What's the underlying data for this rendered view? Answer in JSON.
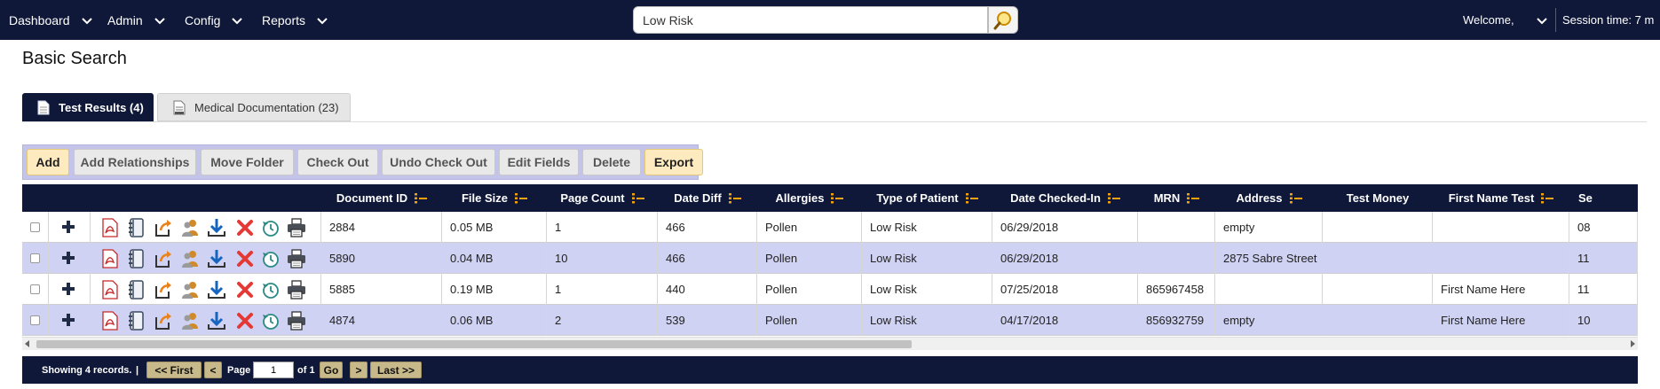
{
  "nav": {
    "items": [
      "Dashboard",
      "Admin",
      "Config",
      "Reports"
    ],
    "search_value": "Low Risk",
    "welcome": "Welcome,",
    "session": "Session time: 7 m"
  },
  "page_title": "Basic Search",
  "tabs": [
    {
      "label": "Test Results (4)",
      "active": true
    },
    {
      "label": "Medical Documentation (23)",
      "active": false
    }
  ],
  "toolbar": {
    "buttons": [
      "Add",
      "Add Relationships",
      "Move Folder",
      "Check Out",
      "Undo Check Out",
      "Edit Fields",
      "Delete",
      "Export"
    ]
  },
  "grid": {
    "columns": [
      "Document ID",
      "File Size",
      "Page Count",
      "Date Diff",
      "Allergies",
      "Type of Patient",
      "Date Checked-In",
      "MRN",
      "Address",
      "Test Money",
      "First Name Test",
      "Se"
    ],
    "row_icons": [
      "pdf-icon",
      "notebook-icon",
      "export-arrow-icon",
      "users-icon",
      "download-icon",
      "delete-x-icon",
      "history-icon",
      "print-icon"
    ],
    "rows": [
      [
        "2884",
        "0.05 MB",
        "1",
        "466",
        "Pollen",
        "Low Risk",
        "06/29/2018",
        "",
        "empty",
        "",
        "",
        "08"
      ],
      [
        "5890",
        "0.04 MB",
        "10",
        "466",
        "Pollen",
        "Low Risk",
        "06/29/2018",
        "",
        "2875 Sabre Street",
        "",
        "",
        "11"
      ],
      [
        "5885",
        "0.19 MB",
        "1",
        "440",
        "Pollen",
        "Low Risk",
        "07/25/2018",
        "865967458",
        "",
        "",
        "First Name Here",
        "11"
      ],
      [
        "4874",
        "0.06 MB",
        "2",
        "539",
        "Pollen",
        "Low Risk",
        "04/17/2018",
        "856932759",
        "empty",
        "",
        "First Name Here",
        "10"
      ]
    ]
  },
  "pager": {
    "showing": "Showing 4 records.",
    "separator": "|",
    "first": "<< First",
    "prev": "<",
    "page_label": "Page",
    "page_value": "1",
    "of_label": "of 1",
    "go": "Go",
    "next": ">",
    "last": "Last >>"
  },
  "colors": {
    "navy": "#0f1838",
    "row_alt": "#cfd2f2",
    "toolbar_bg": "#c4c4ea",
    "primary_button": "#fdebbf",
    "accent_orange": "#f2a20c"
  }
}
